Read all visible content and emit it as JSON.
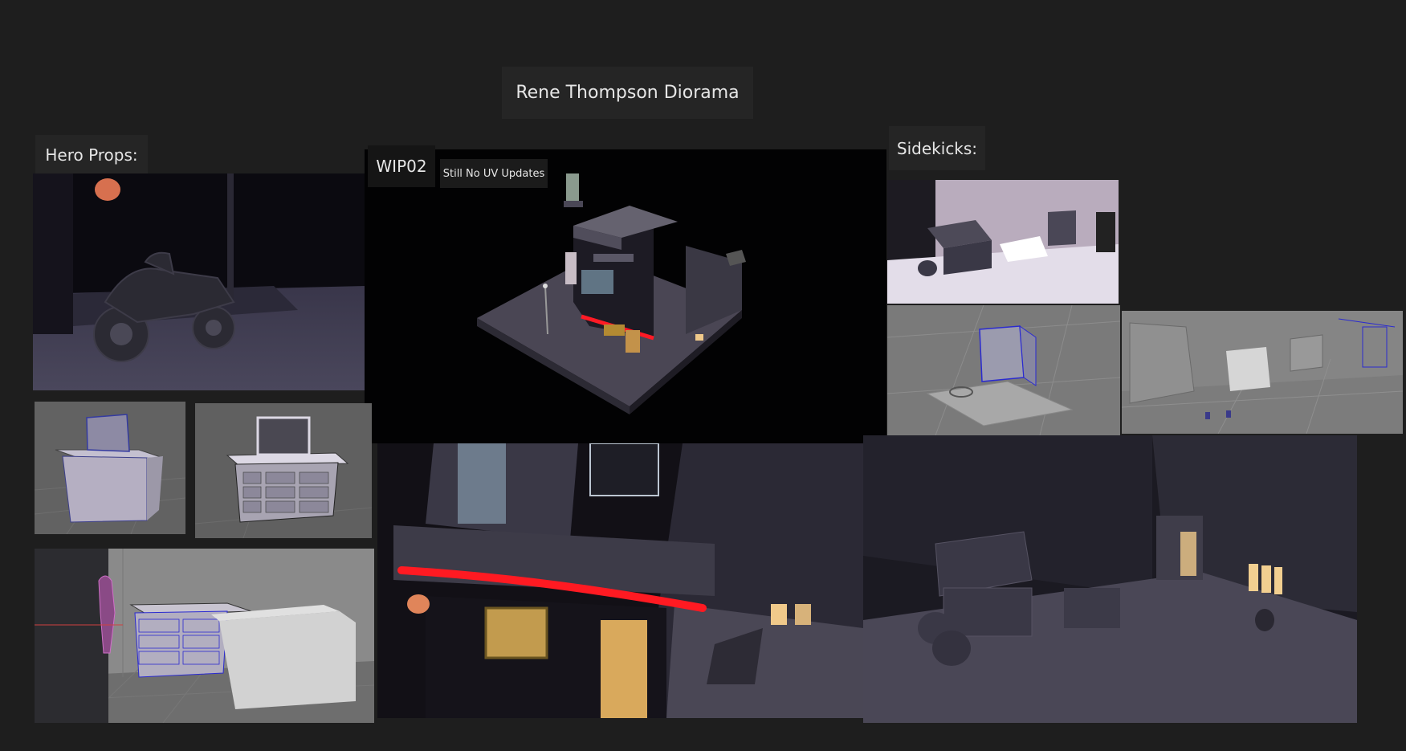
{
  "board": {
    "title": "Rene Thompson Diorama",
    "sections": {
      "hero_props": "Hero Props:",
      "sidekicks": "Sidekicks:",
      "wip": "WIP02",
      "wip_note": "Still No UV Updates"
    }
  },
  "colors": {
    "background": "#1e1e1e",
    "label_bg": "#252525",
    "neon": "#e0141e",
    "warm_light": "#f0c98a",
    "wire": "#2a2ad0"
  },
  "images": [
    {
      "name": "motorcycle-render"
    },
    {
      "name": "wip-diorama-render"
    },
    {
      "name": "dresser-wireframe"
    },
    {
      "name": "dresser-render"
    },
    {
      "name": "dresser-scene-wireframe"
    },
    {
      "name": "storefront-closeup-render"
    },
    {
      "name": "alley-sidekicks-render"
    },
    {
      "name": "boxes-render"
    },
    {
      "name": "dumpster-wireframe"
    },
    {
      "name": "alley-props-wireframe"
    }
  ]
}
